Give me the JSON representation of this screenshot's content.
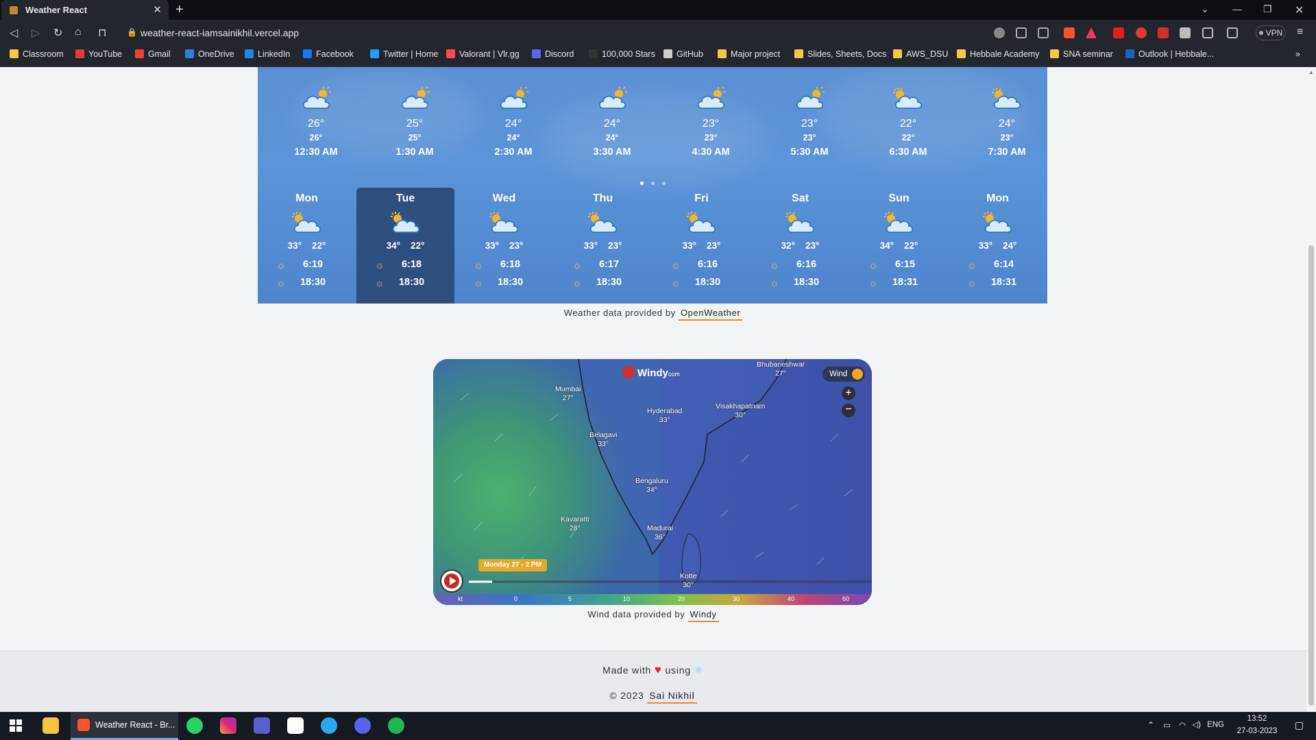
{
  "browser": {
    "tab_title": "Weather React",
    "url": "weather-react-iamsainikhil.vercel.app",
    "vpn_label": "VPN",
    "bookmarks": [
      "Classroom",
      "YouTube",
      "Gmail",
      "OneDrive",
      "LinkedIn",
      "Facebook",
      "Twitter | Home",
      "Valorant | Vlr.gg",
      "Discord",
      "100,000 Stars",
      "GitHub",
      "Major project",
      "Slides, Sheets, Docs",
      "AWS_DSU",
      "Hebbale Academy",
      "SNA seminar",
      "Outlook | Hebbale..."
    ],
    "bookmark_colors": [
      "#f2c94c",
      "#e53935",
      "#ea4335",
      "#2f7de1",
      "#1e88e5",
      "#1877f2",
      "#1da1f2",
      "#ff4655",
      "#5865f2",
      "#333333",
      "#cccccc",
      "#f6c744",
      "#f6c744",
      "#f6c744",
      "#f6c744",
      "#f6c744",
      "#1565c0"
    ]
  },
  "hourly": [
    {
      "temp": "26°",
      "feels": "26°",
      "time": "12:30 AM"
    },
    {
      "temp": "25°",
      "feels": "25°",
      "time": "1:30 AM"
    },
    {
      "temp": "24°",
      "feels": "24°",
      "time": "2:30 AM"
    },
    {
      "temp": "24°",
      "feels": "24°",
      "time": "3:30 AM"
    },
    {
      "temp": "23°",
      "feels": "23°",
      "time": "4:30 AM"
    },
    {
      "temp": "23°",
      "feels": "23°",
      "time": "5:30 AM"
    },
    {
      "temp": "22°",
      "feels": "22°",
      "time": "6:30 AM"
    },
    {
      "temp": "24°",
      "feels": "23°",
      "time": "7:30 AM"
    }
  ],
  "daily": [
    {
      "day": "Mon",
      "max": "33°",
      "min": "22°",
      "sunrise": "6:19",
      "sunset": "18:30"
    },
    {
      "day": "Tue",
      "max": "34°",
      "min": "22°",
      "sunrise": "6:18",
      "sunset": "18:30",
      "selected": true
    },
    {
      "day": "Wed",
      "max": "33°",
      "min": "23°",
      "sunrise": "6:18",
      "sunset": "18:30"
    },
    {
      "day": "Thu",
      "max": "33°",
      "min": "23°",
      "sunrise": "6:17",
      "sunset": "18:30"
    },
    {
      "day": "Fri",
      "max": "33°",
      "min": "23°",
      "sunrise": "6:16",
      "sunset": "18:30"
    },
    {
      "day": "Sat",
      "max": "32°",
      "min": "23°",
      "sunrise": "6:16",
      "sunset": "18:30"
    },
    {
      "day": "Sun",
      "max": "34°",
      "min": "22°",
      "sunrise": "6:15",
      "sunset": "18:31"
    },
    {
      "day": "Mon",
      "max": "33°",
      "min": "24°",
      "sunrise": "6:14",
      "sunset": "18:31"
    }
  ],
  "weather_credit": {
    "prefix": "Weather data provided by",
    "link": "OpenWeather"
  },
  "map": {
    "brand": "Windy",
    "brand_suffix": "com",
    "layer_label": "Wind",
    "timeline_label": "Monday 27 - 2 PM",
    "scale_unit": "kt",
    "scale_ticks": [
      "0",
      "5",
      "10",
      "20",
      "30",
      "40",
      "60"
    ],
    "cities": [
      {
        "name": "Mumbai",
        "temp": "27°"
      },
      {
        "name": "Hyderabad",
        "temp": "33°"
      },
      {
        "name": "Visakhapatnam",
        "temp": "30°"
      },
      {
        "name": "Bhubaneshwar",
        "temp": "27°"
      },
      {
        "name": "Belagavi",
        "temp": "33°"
      },
      {
        "name": "Bengaluru",
        "temp": "34°"
      },
      {
        "name": "Kavaratti",
        "temp": "28°"
      },
      {
        "name": "Madurai",
        "temp": "36°"
      },
      {
        "name": "Kotte",
        "temp": "30°"
      }
    ]
  },
  "wind_credit": {
    "prefix": "Wind data provided by",
    "link": "Windy"
  },
  "footer": {
    "made_with": "Made with",
    "using": "using",
    "copyright": "© 2023",
    "author": "Sai Nikhil"
  },
  "taskbar": {
    "task_label": "Weather React - Br...",
    "lang": "ENG",
    "time": "13:52",
    "date": "27-03-2023"
  }
}
